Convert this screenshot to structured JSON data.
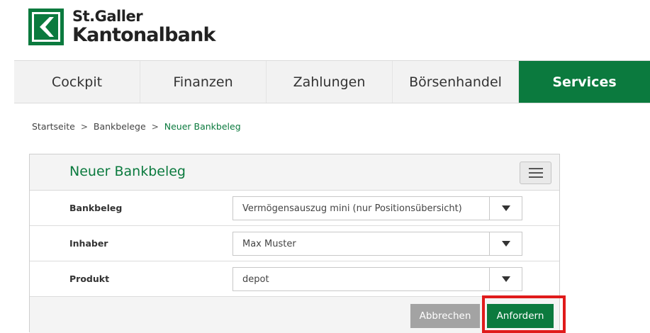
{
  "brand": {
    "line1": "St.Galler",
    "line2": "Kantonalbank",
    "accent": "#0b7a3e"
  },
  "nav": {
    "items": [
      {
        "label": "Cockpit"
      },
      {
        "label": "Finanzen"
      },
      {
        "label": "Zahlungen"
      },
      {
        "label": "Börsenhandel"
      },
      {
        "label": "Services"
      }
    ],
    "active": "Services"
  },
  "breadcrumb": {
    "items": [
      "Startseite",
      "Bankbelege",
      "Neuer Bankbeleg"
    ],
    "separator": ">"
  },
  "panel": {
    "title": "Neuer Bankbeleg",
    "menu_icon": "hamburger-menu-icon",
    "fields": [
      {
        "label": "Bankbeleg",
        "value": "Vermögensauszug mini (nur Positionsübersicht)"
      },
      {
        "label": "Inhaber",
        "value": "Max Muster"
      },
      {
        "label": "Produkt",
        "value": "depot"
      }
    ],
    "buttons": {
      "cancel": "Abbrechen",
      "submit": "Anfordern"
    }
  },
  "colors": {
    "accent": "#0b7a3e",
    "highlight": "#e01b1b",
    "cancel_button": "#a3a3a3"
  }
}
